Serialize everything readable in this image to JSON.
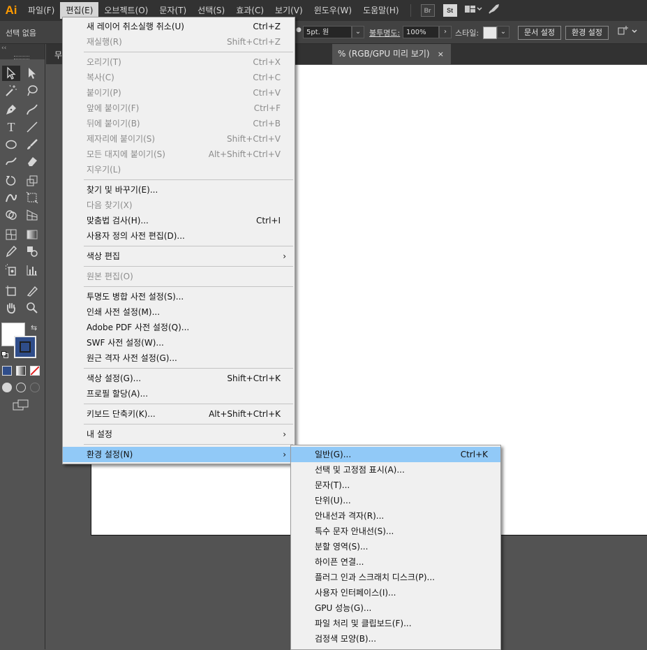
{
  "app": {
    "logo_text": "Ai"
  },
  "menubar": {
    "items": [
      {
        "label": "파일(F)"
      },
      {
        "label": "편집(E)"
      },
      {
        "label": "오브젝트(O)"
      },
      {
        "label": "문자(T)"
      },
      {
        "label": "선택(S)"
      },
      {
        "label": "효과(C)"
      },
      {
        "label": "보기(V)"
      },
      {
        "label": "윈도우(W)"
      },
      {
        "label": "도움말(H)"
      }
    ],
    "bridge_label": "Br",
    "stock_label": "St"
  },
  "controlbar": {
    "selection_status": "선택 없음",
    "stroke_profile": "5pt. 원",
    "opacity_label": "불투명도:",
    "opacity_value": "100%",
    "style_label": "스타일:",
    "doc_setup_button": "문서 설정",
    "preferences_button": "환경 설정"
  },
  "document_tab": {
    "left_partial": "무",
    "title": "% (RGB/GPU 미리 보기)",
    "close_glyph": "×"
  },
  "edit_menu": {
    "items": [
      {
        "label": "새 레이어 취소실행 취소(U)",
        "shortcut": "Ctrl+Z",
        "disabled": false
      },
      {
        "label": "재실행(R)",
        "shortcut": "Shift+Ctrl+Z",
        "disabled": true
      },
      {
        "label": "오리기(T)",
        "shortcut": "Ctrl+X",
        "disabled": true
      },
      {
        "label": "복사(C)",
        "shortcut": "Ctrl+C",
        "disabled": true
      },
      {
        "label": "붙이기(P)",
        "shortcut": "Ctrl+V",
        "disabled": true
      },
      {
        "label": "앞에 붙이기(F)",
        "shortcut": "Ctrl+F",
        "disabled": true
      },
      {
        "label": "뒤에 붙이기(B)",
        "shortcut": "Ctrl+B",
        "disabled": true
      },
      {
        "label": "제자리에 붙이기(S)",
        "shortcut": "Shift+Ctrl+V",
        "disabled": true
      },
      {
        "label": "모든 대지에 붙이기(S)",
        "shortcut": "Alt+Shift+Ctrl+V",
        "disabled": true
      },
      {
        "label": "지우기(L)",
        "shortcut": "",
        "disabled": true
      },
      {
        "label": "찾기 및 바꾸기(E)...",
        "shortcut": "",
        "disabled": false
      },
      {
        "label": "다음 찾기(X)",
        "shortcut": "",
        "disabled": true
      },
      {
        "label": "맞춤법 검사(H)...",
        "shortcut": "Ctrl+I",
        "disabled": false
      },
      {
        "label": "사용자 정의 사전 편집(D)...",
        "shortcut": "",
        "disabled": false
      },
      {
        "label": "색상 편집",
        "shortcut": "",
        "disabled": false,
        "submenu": true
      },
      {
        "label": "원본 편집(O)",
        "shortcut": "",
        "disabled": true
      },
      {
        "label": "투명도 병합 사전 설정(S)...",
        "shortcut": "",
        "disabled": false
      },
      {
        "label": "인쇄 사전 설정(M)...",
        "shortcut": "",
        "disabled": false
      },
      {
        "label": "Adobe PDF 사전 설정(Q)...",
        "shortcut": "",
        "disabled": false
      },
      {
        "label": "SWF 사전 설정(W)...",
        "shortcut": "",
        "disabled": false
      },
      {
        "label": "원근 격자 사전 설정(G)...",
        "shortcut": "",
        "disabled": false
      },
      {
        "label": "색상 설정(G)...",
        "shortcut": "Shift+Ctrl+K",
        "disabled": false
      },
      {
        "label": "프로필 할당(A)...",
        "shortcut": "",
        "disabled": false
      },
      {
        "label": "키보드 단축키(K)...",
        "shortcut": "Alt+Shift+Ctrl+K",
        "disabled": false
      },
      {
        "label": "내 설정",
        "shortcut": "",
        "disabled": false,
        "submenu": true
      },
      {
        "label": "환경 설정(N)",
        "shortcut": "",
        "disabled": false,
        "submenu": true,
        "highlighted": true
      }
    ],
    "submenu_arrow": "›"
  },
  "preferences_submenu": {
    "items": [
      {
        "label": "일반(G)...",
        "shortcut": "Ctrl+K",
        "highlighted": true
      },
      {
        "label": "선택 및 고정점 표시(A)...",
        "shortcut": ""
      },
      {
        "label": "문자(T)...",
        "shortcut": ""
      },
      {
        "label": "단위(U)...",
        "shortcut": ""
      },
      {
        "label": "안내선과 격자(R)...",
        "shortcut": ""
      },
      {
        "label": "특수 문자 안내선(S)...",
        "shortcut": ""
      },
      {
        "label": "분할 영역(S)...",
        "shortcut": ""
      },
      {
        "label": "하이픈 연결...",
        "shortcut": ""
      },
      {
        "label": "플러그 인과 스크래치 디스크(P)...",
        "shortcut": ""
      },
      {
        "label": "사용자 인터페이스(I)...",
        "shortcut": ""
      },
      {
        "label": "GPU 성능(G)...",
        "shortcut": ""
      },
      {
        "label": "파일 처리 및 클립보드(F)...",
        "shortcut": ""
      },
      {
        "label": "검정색 모양(B)...",
        "shortcut": ""
      }
    ]
  },
  "colors": {
    "menu_highlight": "#91c9f7",
    "stroke_swatch": "#2f4d8a",
    "logo_orange": "#ff9a00"
  }
}
